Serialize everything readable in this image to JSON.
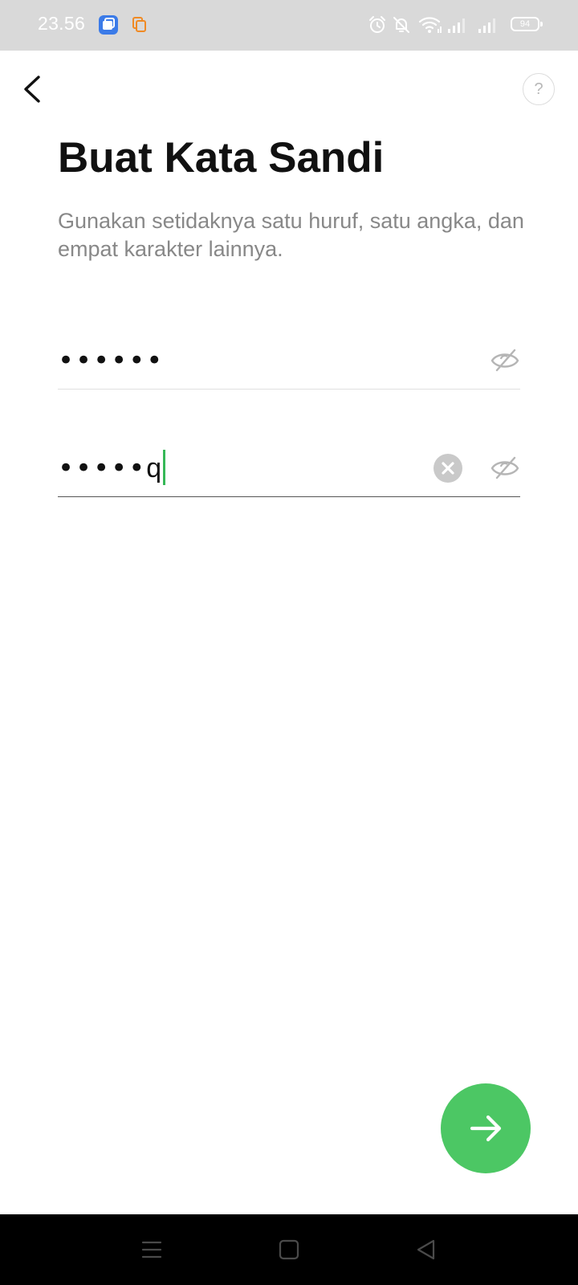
{
  "status_bar": {
    "time": "23.56",
    "battery_level": "94",
    "notification_icons": [
      "app-notification-icon",
      "copy-notification-icon"
    ],
    "system_icons": [
      "alarm-icon",
      "bell-off-icon",
      "wifi-icon",
      "signal-icon",
      "signal-icon",
      "battery-icon"
    ]
  },
  "header": {
    "back_icon": "chevron-left-icon",
    "help_label": "?"
  },
  "main": {
    "title": "Buat Kata Sandi",
    "subtitle": "Gunakan setidaknya satu huruf, satu angka, dan empat karakter lainnya.",
    "password_field": {
      "value": "••••••",
      "toggle_icon": "eye-off-icon"
    },
    "confirm_field": {
      "masked": "•••••",
      "last_char": "q",
      "clear_icon": "clear-icon",
      "toggle_icon": "eye-off-icon"
    },
    "next_icon": "arrow-right-icon",
    "accent_color": "#4cc764",
    "caret_color": "#36b857"
  },
  "nav_bar": {
    "icons": [
      "menu-icon",
      "home-icon",
      "back-icon"
    ]
  }
}
